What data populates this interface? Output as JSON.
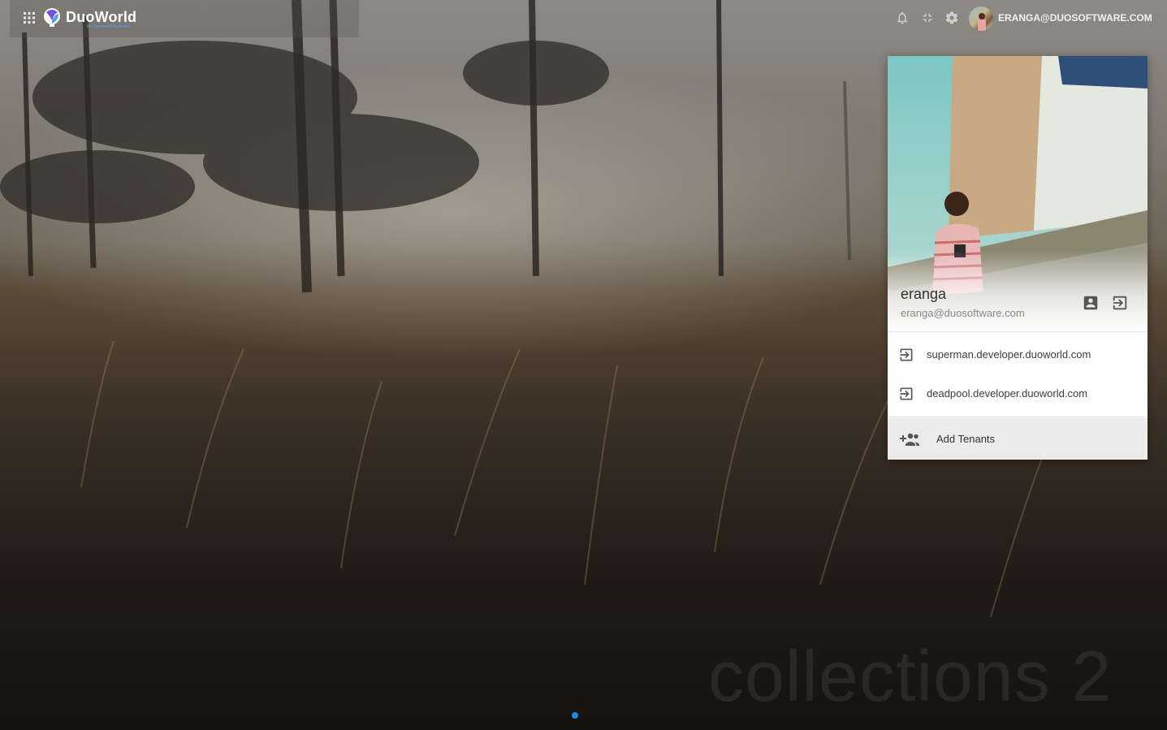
{
  "app": {
    "brand": "DuoWorld",
    "tagline": "for Connected Business"
  },
  "topbar": {
    "icons": [
      "apps-grid-icon",
      "bell-icon",
      "collapse-icon",
      "gear-icon"
    ],
    "user_label": "ERANGA@DUOSOFTWARE.COM"
  },
  "profile": {
    "name": "eranga",
    "email": "eranga@duosoftware.com",
    "actions": [
      "account-box-icon",
      "sign-in-icon"
    ],
    "tenants": [
      {
        "label": "superman.developer.duoworld.com",
        "icon": "sign-in-icon"
      },
      {
        "label": "deadpool.developer.duoworld.com",
        "icon": "sign-in-icon"
      }
    ],
    "add_tenants_label": "Add Tenants"
  },
  "desktop": {
    "collection_title": "collections 2"
  },
  "colors": {
    "accent": "#1e88e5",
    "brand_blue": "#4fa3e8",
    "brand_purple": "#7b4fd6"
  }
}
